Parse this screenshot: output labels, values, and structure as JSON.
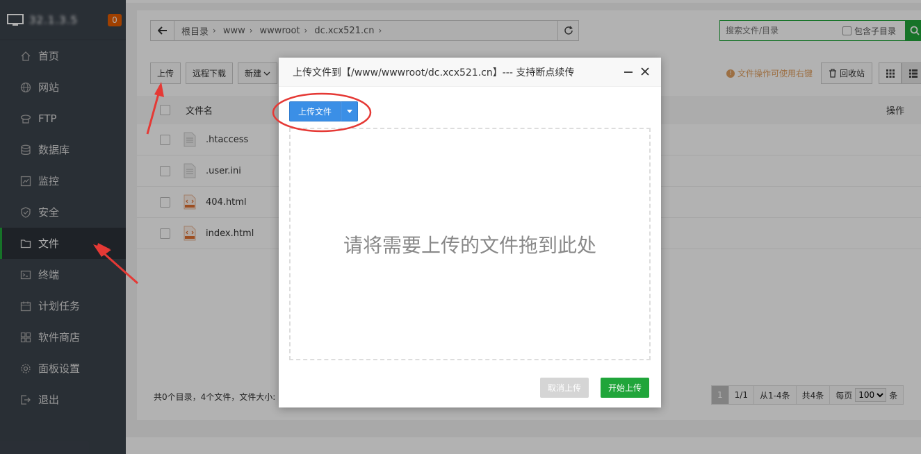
{
  "sidebar": {
    "host": "32.1.3.5",
    "badge": "0",
    "items": [
      {
        "label": "首页",
        "icon": "home-icon"
      },
      {
        "label": "网站",
        "icon": "globe-icon"
      },
      {
        "label": "FTP",
        "icon": "ftp-icon"
      },
      {
        "label": "数据库",
        "icon": "database-icon"
      },
      {
        "label": "监控",
        "icon": "monitor-chart-icon"
      },
      {
        "label": "安全",
        "icon": "shield-icon"
      },
      {
        "label": "文件",
        "icon": "folder-icon",
        "active": true
      },
      {
        "label": "终端",
        "icon": "terminal-icon"
      },
      {
        "label": "计划任务",
        "icon": "calendar-icon"
      },
      {
        "label": "软件商店",
        "icon": "apps-grid-icon"
      },
      {
        "label": "面板设置",
        "icon": "gear-icon"
      },
      {
        "label": "退出",
        "icon": "logout-icon"
      }
    ]
  },
  "path": {
    "crumbs": [
      "根目录",
      "www",
      "wwwroot",
      "dc.xcx521.cn"
    ]
  },
  "search": {
    "placeholder": "搜索文件/目录",
    "include_sub_label": "包含子目录"
  },
  "toolbar": {
    "upload": "上传",
    "remote_download": "远程下载",
    "new": "新建"
  },
  "tip": "文件操作可使用右键",
  "recycle": "回收站",
  "table": {
    "col_name": "文件名",
    "col_ops": "操作",
    "rows": [
      {
        "name": ".htaccess",
        "type": "text"
      },
      {
        "name": ".user.ini",
        "type": "text"
      },
      {
        "name": "404.html",
        "type": "html"
      },
      {
        "name": "index.html",
        "type": "html"
      }
    ]
  },
  "summary": "共0个目录，4个文件，文件大小: ",
  "pager": {
    "current": "1",
    "pages": "1/1",
    "range": "从1-4条",
    "total": "共4条",
    "per_page_label": "每页",
    "per_page": "100",
    "unit": "条"
  },
  "modal": {
    "title": "上传文件到【/www/wwwroot/dc.xcx521.cn】--- 支持断点续传",
    "upload_button": "上传文件",
    "drop_text": "请将需要上传的文件拖到此处",
    "cancel": "取消上传",
    "start": "开始上传"
  },
  "colors": {
    "sidebar_bg": "#3c444d",
    "accent_green": "#20a53a",
    "upload_blue": "#3b8fe6",
    "annotation_red": "#e53935"
  }
}
